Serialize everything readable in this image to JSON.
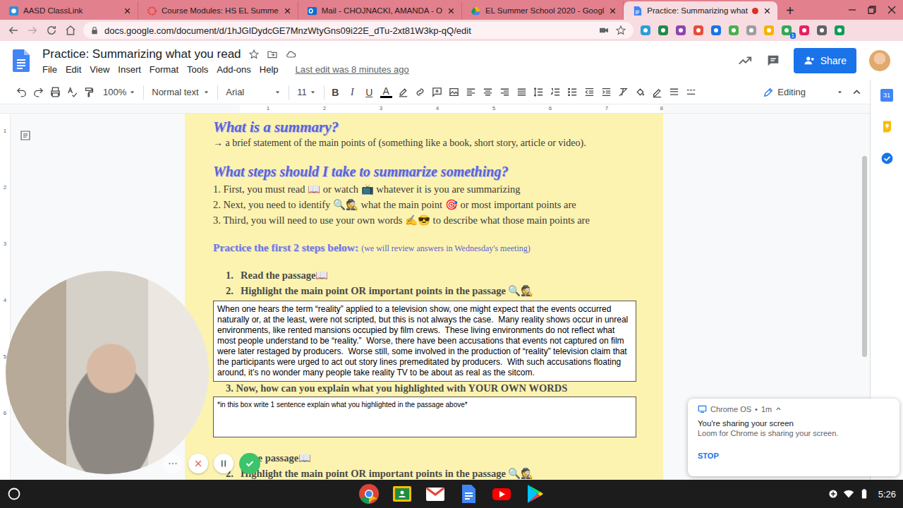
{
  "browser": {
    "tabs": [
      {
        "label": "AASD ClassLink",
        "selected": false,
        "recording": false,
        "kind": "classlink"
      },
      {
        "label": "Course Modules: HS EL Summe",
        "selected": false,
        "recording": false,
        "kind": "canvas"
      },
      {
        "label": "Mail - CHOJNACKI, AMANDA - O",
        "selected": false,
        "recording": false,
        "kind": "outlook"
      },
      {
        "label": "EL Summer School 2020 - Googl",
        "selected": false,
        "recording": false,
        "kind": "drive"
      },
      {
        "label": "Practice: Summarizing what",
        "selected": true,
        "recording": true,
        "kind": "docs"
      }
    ],
    "new_tab": "+",
    "url": "docs.google.com/document/d/1hJGIDydcGE7MnzWtyGns09i22E_dTu-2xt81W3kp-qQ/edit",
    "extension_badge": "1"
  },
  "docs": {
    "title": "Practice: Summarizing what you read",
    "menus": [
      "File",
      "Edit",
      "View",
      "Insert",
      "Format",
      "Tools",
      "Add-ons",
      "Help"
    ],
    "last_edit": "Last edit was 8 minutes ago",
    "share": "Share",
    "calendar_day": "31"
  },
  "toolbar": {
    "zoom": "100%",
    "style": "Normal text",
    "font": "Arial",
    "size": "11",
    "format_buttons": [
      "B",
      "I",
      "U",
      "A"
    ],
    "mode": "Editing"
  },
  "ruler": {
    "horizontal": [
      "1",
      "2",
      "3",
      "4",
      "5",
      "6",
      "7",
      "8"
    ],
    "vertical": [
      "1",
      "2",
      "3",
      "4",
      "5",
      "6"
    ]
  },
  "document": {
    "heading1": "What is a summary?",
    "definition": "→ a brief statement of the main points of (something like a book, short story, article or video).",
    "heading2": "What steps should I take to summarize something?",
    "steps": [
      "1. First, you must read 📖 or watch 📺 whatever it is you are summarizing",
      "2. Next, you need to identify 🔍🕵  what the main point 🎯 or most important points are",
      "3. Third, you will need to use your own words ✍😎 to describe what those main points are"
    ],
    "practice_heading": "Practice the first 2 steps below:",
    "practice_note": "(we will review answers in Wednesday's meeting)",
    "tasks": [
      {
        "number": "1.",
        "text": "Read the passage📖"
      },
      {
        "number": "2.",
        "text": "Highlight the main point OR important points in the passage 🔍🕵"
      }
    ],
    "passage": "When one hears the term “reality” applied to a television show, one might expect that the events occurred naturally or, at the least, were not scripted, but this is not always the case.  Many reality shows occur in unreal environments, like rented mansions occupied by film crews.  These living environments do not reflect what most people understand to be “reality.”  Worse, there have been accusations that events not captured on film were later restaged by producers.  Worse still, some involved in the production of “reality” television claim that the participants were urged to act out story lines premeditated by producers.  With such accusations floating around, it’s no wonder many people take reality TV to be about as real as the sitcom.",
    "explain_prompt": "3. Now, how can you explain what you highlighted with YOUR OWN WORDS",
    "answer_placeholder": "*in this box write 1 sentence explain what you highlighted in the passage above*",
    "next_tasks": [
      {
        "text": "d the passage📖"
      },
      {
        "number": "2.",
        "text": "Highlight the main point OR important points in the passage 🔍🕵"
      }
    ]
  },
  "notification": {
    "source": "Chrome OS",
    "separator": "•",
    "age": "1m",
    "title": "You're sharing your screen",
    "body": "Loom for Chrome is sharing your screen.",
    "action": "STOP"
  },
  "shelf": {
    "time": "5:26"
  }
}
